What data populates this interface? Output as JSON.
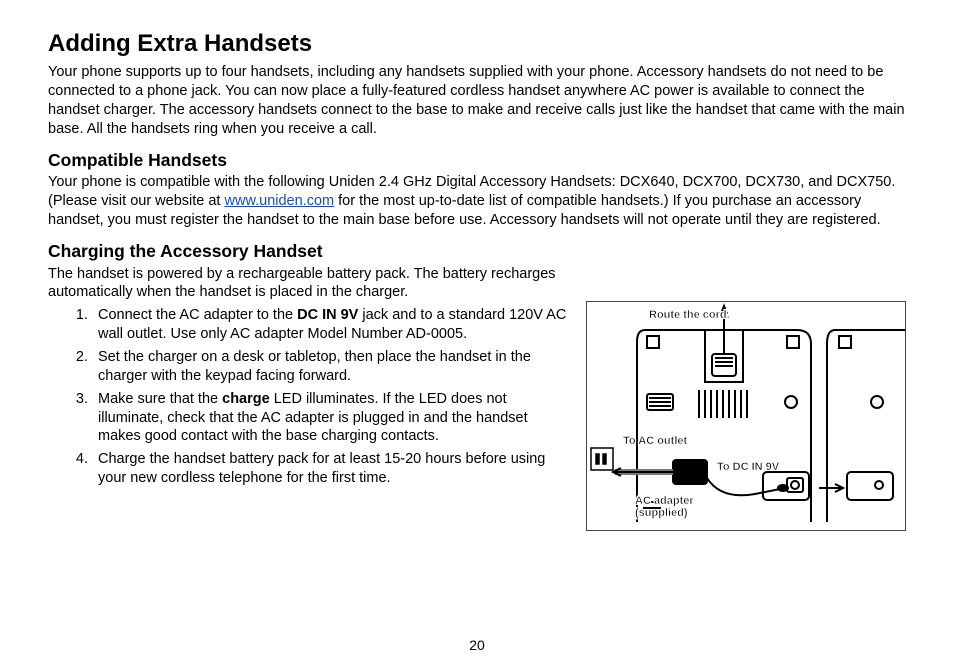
{
  "page_number": "20",
  "h1": "Adding Extra Handsets",
  "intro": "Your phone supports up to four handsets, including any handsets supplied with your phone. Accessory handsets do not need to be connected to a phone jack. You can now place a fully-featured cordless handset anywhere AC power is available to connect the handset charger. The accessory handsets connect to the base to make and receive calls just like the handset that came with the main base. All the handsets ring when you receive a call.",
  "h2a": "Compatible Handsets",
  "compat_a": "Your phone is compatible with the following Uniden 2.4 GHz Digital Accessory Handsets: DCX640, DCX700, DCX730, and DCX750. (Please visit our website at ",
  "compat_link": "www.uniden.com",
  "compat_b": " for the most up-to-date list of compatible handsets.) If you purchase an accessory handset, you must register the handset to the main base before use. Accessory handsets will not operate until they are registered.",
  "h2b": "Charging the Accessory Handset",
  "charge_intro": "The handset is powered by a rechargeable battery pack. The battery recharges automatically when the handset is placed in the charger.",
  "steps": {
    "s1a": "Connect the AC adapter to the ",
    "s1b": "DC IN 9V",
    "s1c": " jack and to a standard 120V AC wall outlet. Use only AC adapter Model Number AD-0005.",
    "s2": "Set the charger on a desk or tabletop, then place the handset in the charger with the keypad facing forward.",
    "s3a": "Make sure that the ",
    "s3b": "charge",
    "s3c": " LED illuminates. If the LED does not illuminate, check that the AC adapter is plugged in and the handset makes good contact with the base charging contacts.",
    "s4": "Charge the handset battery pack for at least 15-20 hours before using your new cordless telephone for the first time."
  },
  "figure": {
    "route": "Route the cord.",
    "ac_outlet": "To AC outlet",
    "dc_in": "To DC IN 9V",
    "adapter": "AC adapter",
    "supplied": "(supplied)"
  }
}
